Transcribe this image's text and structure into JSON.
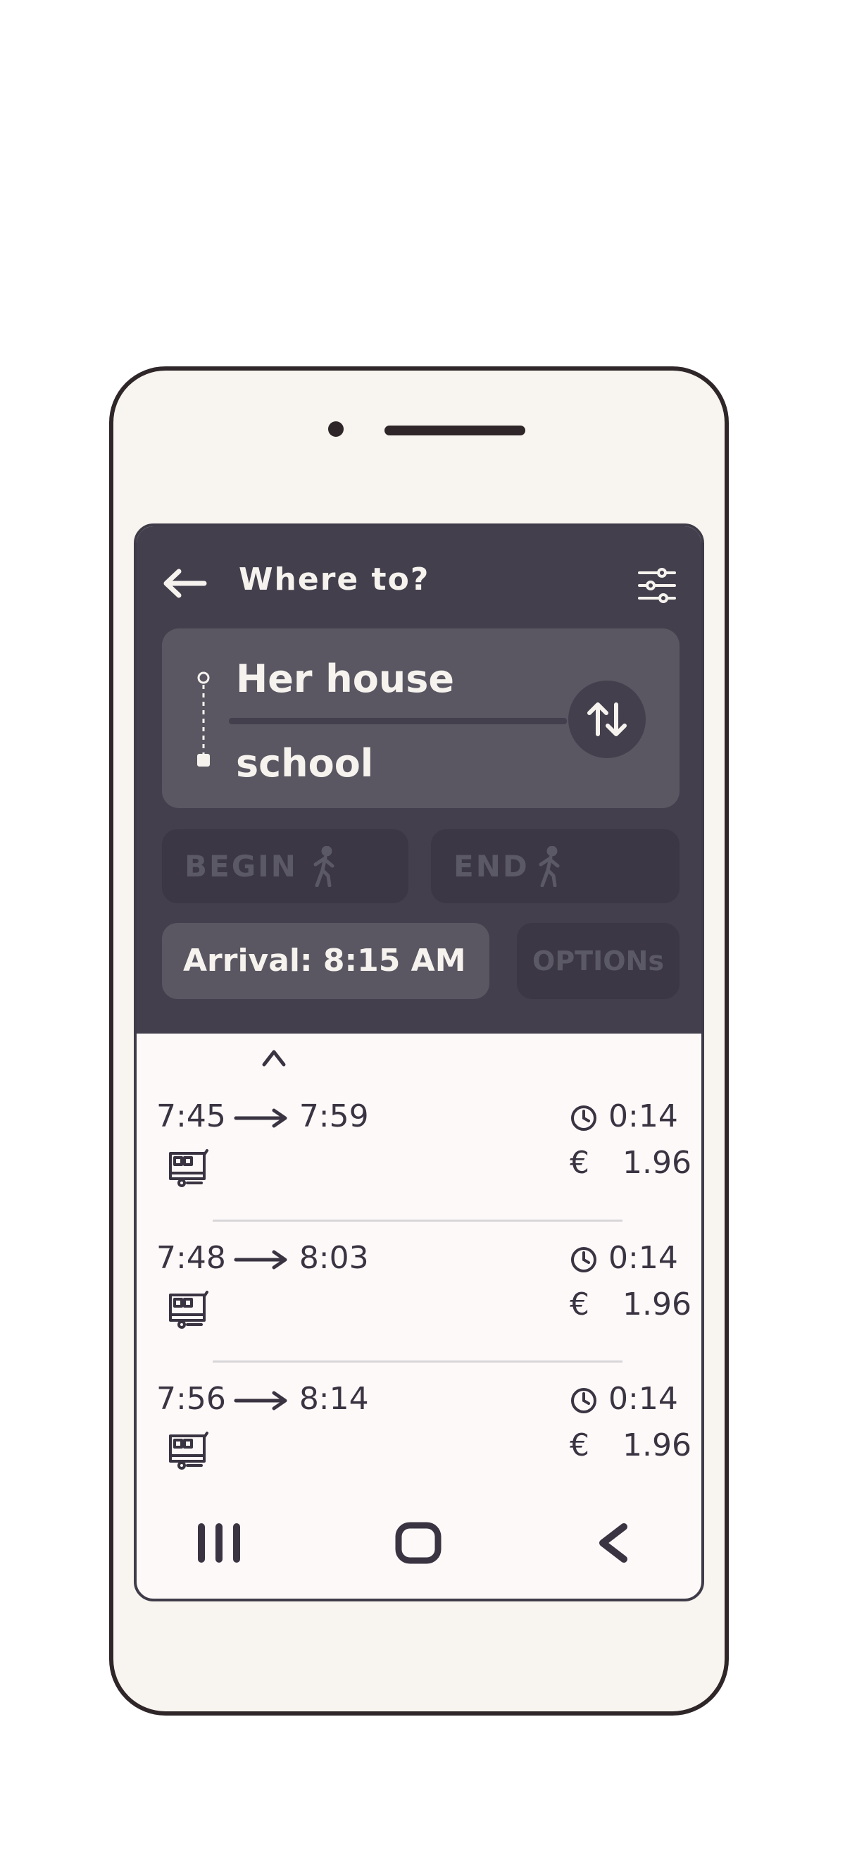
{
  "header": {
    "title": "Where to?",
    "back_icon": "arrow-left-icon",
    "filter_icon": "sliders-icon"
  },
  "route": {
    "from": "Her house",
    "to": "school",
    "swap_icon": "swap-vertical-icon"
  },
  "buttons": {
    "begin_label": "BEGIN",
    "end_label": "END",
    "arrival_label": "Arrival: 8:15 AM",
    "options_label": "OPTIONs"
  },
  "trips": [
    {
      "depart": "7:45",
      "arrive": "7:59",
      "duration": "0:14",
      "currency": "€",
      "price": "1.96",
      "mode_icon": "tram-icon"
    },
    {
      "depart": "7:48",
      "arrive": "8:03",
      "duration": "0:14",
      "currency": "€",
      "price": "1.96",
      "mode_icon": "tram-icon"
    },
    {
      "depart": "7:56",
      "arrive": "8:14",
      "duration": "0:14",
      "currency": "€",
      "price": "1.96",
      "mode_icon": "tram-icon"
    }
  ],
  "colors": {
    "header_bg": "#433f4d",
    "card_bg": "#5a5762",
    "button_dark": "#3b3744",
    "text_light": "#f6f3ef",
    "text_dark": "#3a3442",
    "screen_bg": "#fcf9f8",
    "phone_body": "#f8f4ef"
  }
}
